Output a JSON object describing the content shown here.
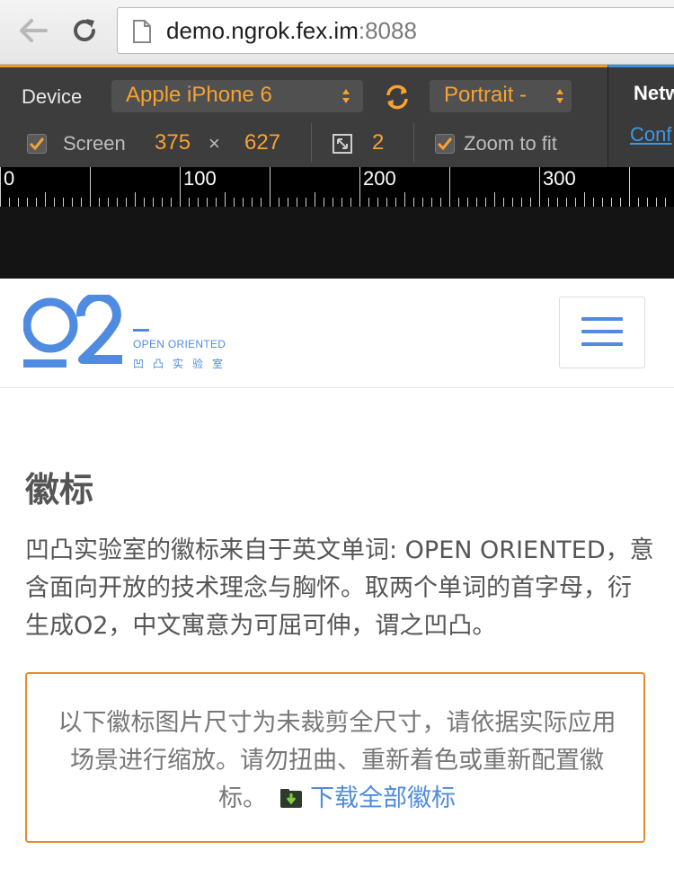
{
  "browser": {
    "url_host": "demo.ngrok.fex.im",
    "url_port": ":8088"
  },
  "devtools": {
    "device_label": "Device",
    "device_value": "Apple iPhone 6",
    "orientation_value": "Portrait -",
    "screen_label": "Screen",
    "width": "375",
    "times": "×",
    "height": "627",
    "scale": "2",
    "zoom_label": "Zoom to fit",
    "panel_tab": "Netw",
    "panel_link": "Conf",
    "accent_color": "#f7a231"
  },
  "ruler": {
    "labels": [
      "0",
      "100",
      "200",
      "300"
    ]
  },
  "site": {
    "logo_en": "OPEN ORIENTED",
    "logo_cn": "凹凸实验室",
    "brand_color": "#4f8be0",
    "section_title": "徽标",
    "intro": "凹凸实验室的徽标来自于英文单词: OPEN ORIENTED，意含面向开放的技术理念与胸怀。取两个单词的首字母，衍生成O2，中文寓意为可屈可伸，谓之凹凸。",
    "notice_text": "以下徽标图片尺寸为未裁剪全尺寸，请依据实际应用场景进行缩放。请勿扭曲、重新着色或重新配置徽标。",
    "download_label": "下载全部徽标",
    "notice_border_color": "#e88b2e"
  }
}
